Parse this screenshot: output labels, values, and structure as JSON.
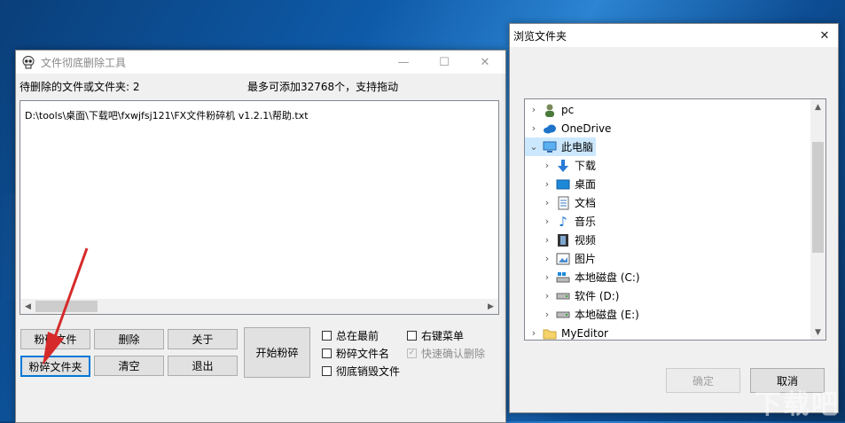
{
  "main_window": {
    "title": "文件彻底删除工具",
    "pending_label": "待删除的文件或文件夹: 2",
    "capacity_label": "最多可添加32768个，支持拖动",
    "list_items": [
      "D:\\tools\\桌面\\下载吧\\fxwjfsj121\\FX文件粉碎机 v1.2.1\\帮助.txt"
    ],
    "buttons": {
      "shred_file": "粉碎文件",
      "delete": "删除",
      "about": "关于",
      "shred_folder": "粉碎文件夹",
      "clear": "清空",
      "exit": "退出",
      "start_shred": "开始粉碎"
    },
    "checkboxes": {
      "always_on_top": {
        "label": "总在最前",
        "checked": false
      },
      "shred_filename": {
        "label": "粉碎文件名",
        "checked": false
      },
      "thorough_destroy": {
        "label": "彻底销毁文件",
        "checked": false
      },
      "context_menu": {
        "label": "右键菜单",
        "checked": false
      },
      "quick_confirm": {
        "label": "快速确认删除",
        "checked": true,
        "disabled": true
      }
    }
  },
  "browse_dialog": {
    "title": "浏览文件夹",
    "tree": [
      {
        "label": "pc",
        "icon": "user-icon",
        "level": 0
      },
      {
        "label": "OneDrive",
        "icon": "cloud-icon",
        "level": 0
      },
      {
        "label": "此电脑",
        "icon": "computer-icon",
        "level": 0,
        "expanded": true,
        "selected": true
      },
      {
        "label": "下载",
        "icon": "download-arrow-icon",
        "level": 1
      },
      {
        "label": "桌面",
        "icon": "desktop-icon",
        "level": 1
      },
      {
        "label": "文档",
        "icon": "document-icon",
        "level": 1
      },
      {
        "label": "音乐",
        "icon": "music-note-icon",
        "level": 1
      },
      {
        "label": "视频",
        "icon": "film-icon",
        "level": 1
      },
      {
        "label": "图片",
        "icon": "picture-icon",
        "level": 1
      },
      {
        "label": "本地磁盘 (C:)",
        "icon": "windows-drive-icon",
        "level": 1
      },
      {
        "label": "软件 (D:)",
        "icon": "drive-icon",
        "level": 1
      },
      {
        "label": "本地磁盘 (E:)",
        "icon": "drive-icon",
        "level": 1
      },
      {
        "label": "MyEditor",
        "icon": "folder-icon",
        "level": 0
      }
    ],
    "ok_label": "确定",
    "cancel_label": "取消"
  },
  "watermark": "下载吧",
  "colors": {
    "accent": "#0078d7",
    "selection": "#cce8ff",
    "annotation_arrow": "#d62a2a"
  }
}
